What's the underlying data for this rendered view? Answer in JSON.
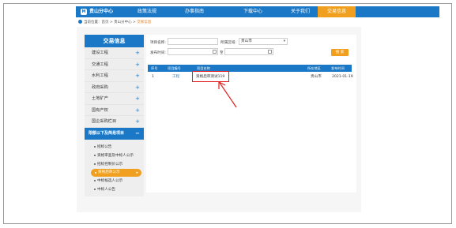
{
  "site": {
    "brand": "贵山分中心",
    "logo_text": "M"
  },
  "nav": [
    {
      "label": "政策法规",
      "active": false
    },
    {
      "label": "办事指南",
      "active": false
    },
    {
      "label": "下载中心",
      "active": false
    },
    {
      "label": "关于我们",
      "active": false
    },
    {
      "label": "交易信息",
      "active": true
    }
  ],
  "breadcrumb": {
    "prefix": "当前位置：首页 > 贵山分中心 > ",
    "current": "交易信息"
  },
  "sidebar": {
    "title": "交易信息",
    "items": [
      {
        "label": "建设工程"
      },
      {
        "label": "交通工程"
      },
      {
        "label": "水利工程"
      },
      {
        "label": "政府采购"
      },
      {
        "label": "土地矿产"
      },
      {
        "label": "国有产权"
      },
      {
        "label": "国企采购栏目"
      }
    ],
    "group": {
      "label": "限额以下及简易项目",
      "subitems": [
        {
          "label": "招标公告",
          "active": false
        },
        {
          "label": "资格审查及中标人公示",
          "active": false
        },
        {
          "label": "招标控制价公示",
          "active": false
        },
        {
          "label": "资格后审公示",
          "active": true
        },
        {
          "label": "中标候选人公示",
          "active": false
        },
        {
          "label": "中标人公告",
          "active": false
        }
      ]
    }
  },
  "filters": {
    "project_name_label": "项目名称:",
    "project_name_value": "",
    "region_label": "所属区域:",
    "region_value": "贵山市",
    "date_label": "发布时间:",
    "date_from": "",
    "date_separator": "至",
    "date_to": "",
    "search_button": "搜 索"
  },
  "table": {
    "columns": [
      "序号",
      "项目编号",
      "项目名称",
      "所在地区",
      "发布时间"
    ],
    "rows": [
      {
        "index": "1",
        "number": "工程",
        "name": "资格后审测试119",
        "region": "贵山市",
        "date": "2021-01-19"
      }
    ]
  },
  "colors": {
    "primary": "#1a78c6",
    "accent": "#f0a01e",
    "highlight": "#e02020"
  }
}
